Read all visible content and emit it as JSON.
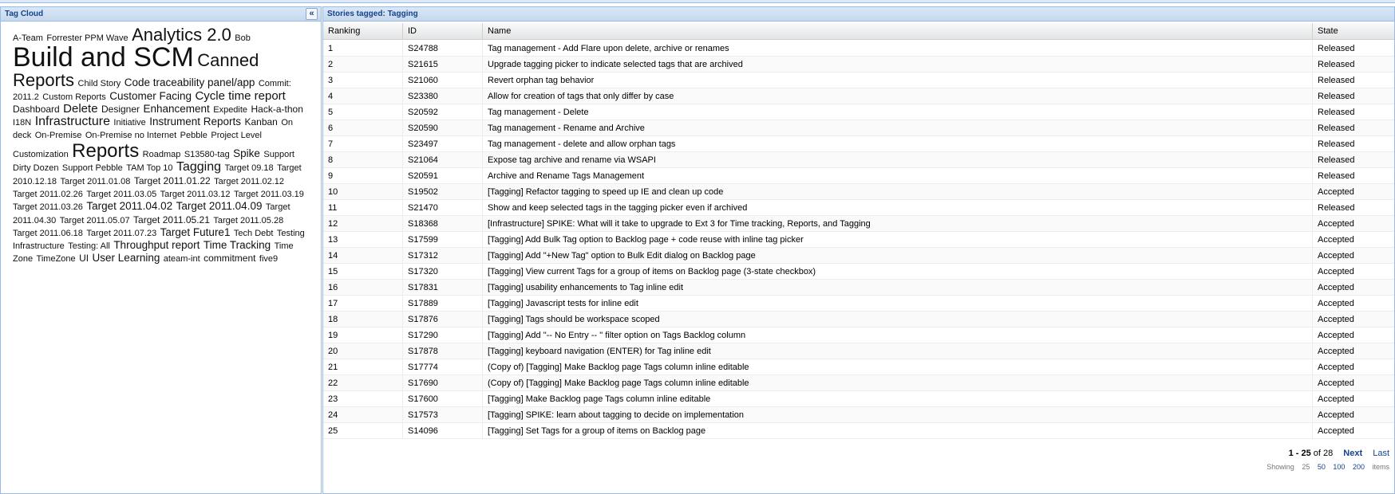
{
  "left_panel": {
    "title": "Tag Cloud",
    "collapse_icon": "«",
    "tags": [
      {
        "text": "A-Team",
        "size": "s11"
      },
      {
        "text": "Forrester PPM Wave",
        "size": "s11"
      },
      {
        "text": "Analytics 2.0",
        "size": "s22"
      },
      {
        "text": "Bob",
        "size": "s11"
      },
      {
        "text": "Build and SCM",
        "size": "s34"
      },
      {
        "text": "Canned Reports",
        "size": "s22"
      },
      {
        "text": "Child Story",
        "size": "s11"
      },
      {
        "text": "Code traceability panel/app",
        "size": "s13"
      },
      {
        "text": "Commit: 2011.2",
        "size": "s11"
      },
      {
        "text": "Custom Reports",
        "size": "s11"
      },
      {
        "text": "Customer Facing",
        "size": "s13"
      },
      {
        "text": "Cycle time report",
        "size": "s15"
      },
      {
        "text": "Dashboard",
        "size": "s12"
      },
      {
        "text": "Delete",
        "size": "s15"
      },
      {
        "text": "Designer",
        "size": "s12"
      },
      {
        "text": "Enhancement",
        "size": "s13"
      },
      {
        "text": "Expedite",
        "size": "s11"
      },
      {
        "text": "Hack-a-thon",
        "size": "s12"
      },
      {
        "text": "I18N",
        "size": "s11"
      },
      {
        "text": "Infrastructure",
        "size": "s16"
      },
      {
        "text": "Initiative",
        "size": "s11"
      },
      {
        "text": "Instrument Reports",
        "size": "s13"
      },
      {
        "text": "Kanban",
        "size": "s12"
      },
      {
        "text": "On deck",
        "size": "s11"
      },
      {
        "text": "On-Premise",
        "size": "s11"
      },
      {
        "text": "On-Premise no Internet",
        "size": "s11"
      },
      {
        "text": "Pebble",
        "size": "s11"
      },
      {
        "text": "Project Level Customization",
        "size": "s11"
      },
      {
        "text": "Reports",
        "size": "s24"
      },
      {
        "text": "Roadmap",
        "size": "s11"
      },
      {
        "text": "S13580-tag",
        "size": "s11"
      },
      {
        "text": "Spike",
        "size": "s13"
      },
      {
        "text": "Support Dirty Dozen",
        "size": "s11"
      },
      {
        "text": "Support Pebble",
        "size": "s11"
      },
      {
        "text": "TAM Top 10",
        "size": "s11"
      },
      {
        "text": "Tagging",
        "size": "s16"
      },
      {
        "text": "Target 09.18",
        "size": "s11"
      },
      {
        "text": "Target 2010.12.18",
        "size": "s11"
      },
      {
        "text": "Target 2011.01.08",
        "size": "s11"
      },
      {
        "text": "Target 2011.01.22",
        "size": "s12"
      },
      {
        "text": "Target 2011.02.12",
        "size": "s11"
      },
      {
        "text": "Target 2011.02.26",
        "size": "s11"
      },
      {
        "text": "Target 2011.03.05",
        "size": "s11"
      },
      {
        "text": "Target 2011.03.12",
        "size": "s11"
      },
      {
        "text": "Target 2011.03.19",
        "size": "s11"
      },
      {
        "text": "Target 2011.03.26",
        "size": "s11"
      },
      {
        "text": "Target 2011.04.02",
        "size": "s13"
      },
      {
        "text": "Target 2011.04.09",
        "size": "s13"
      },
      {
        "text": "Target 2011.04.30",
        "size": "s11"
      },
      {
        "text": "Target 2011.05.07",
        "size": "s11"
      },
      {
        "text": "Target 2011.05.21",
        "size": "s12"
      },
      {
        "text": "Target 2011.05.28",
        "size": "s11"
      },
      {
        "text": "Target 2011.06.18",
        "size": "s11"
      },
      {
        "text": "Target 2011.07.23",
        "size": "s11"
      },
      {
        "text": "Target Future1",
        "size": "s13"
      },
      {
        "text": "Tech Debt",
        "size": "s11"
      },
      {
        "text": "Testing Infrastructure",
        "size": "s11"
      },
      {
        "text": "Testing: All",
        "size": "s11"
      },
      {
        "text": "Throughput report",
        "size": "s13"
      },
      {
        "text": "Time Tracking",
        "size": "s13"
      },
      {
        "text": "Time Zone",
        "size": "s11"
      },
      {
        "text": "TimeZone",
        "size": "s11"
      },
      {
        "text": "UI",
        "size": "s12"
      },
      {
        "text": "User Learning",
        "size": "s13"
      },
      {
        "text": "ateam-int",
        "size": "s11"
      },
      {
        "text": "commitment",
        "size": "s12"
      },
      {
        "text": "five9",
        "size": "s11"
      }
    ]
  },
  "right_panel": {
    "title": "Stories tagged: Tagging",
    "columns": {
      "rank": "Ranking",
      "id": "ID",
      "name": "Name",
      "state": "State"
    },
    "rows": [
      {
        "rank": "1",
        "id": "S24788",
        "name": "Tag management - Add Flare upon delete, archive or renames",
        "state": "Released"
      },
      {
        "rank": "2",
        "id": "S21615",
        "name": "Upgrade tagging picker to indicate selected tags that are archived",
        "state": "Released"
      },
      {
        "rank": "3",
        "id": "S21060",
        "name": "Revert orphan tag behavior",
        "state": "Released"
      },
      {
        "rank": "4",
        "id": "S23380",
        "name": "Allow for creation of tags that only differ by case",
        "state": "Released"
      },
      {
        "rank": "5",
        "id": "S20592",
        "name": "Tag management - Delete",
        "state": "Released"
      },
      {
        "rank": "6",
        "id": "S20590",
        "name": "Tag management - Rename and Archive",
        "state": "Released"
      },
      {
        "rank": "7",
        "id": "S23497",
        "name": "Tag management - delete and allow orphan tags",
        "state": "Released"
      },
      {
        "rank": "8",
        "id": "S21064",
        "name": "Expose tag archive and rename via WSAPI",
        "state": "Released"
      },
      {
        "rank": "9",
        "id": "S20591",
        "name": "Archive and Rename Tags Management",
        "state": "Released"
      },
      {
        "rank": "10",
        "id": "S19502",
        "name": "[Tagging] Refactor tagging to speed up IE and clean up code",
        "state": "Accepted"
      },
      {
        "rank": "11",
        "id": "S21470",
        "name": "Show and keep selected tags in the tagging picker even if archived",
        "state": "Released"
      },
      {
        "rank": "12",
        "id": "S18368",
        "name": "[Infrastructure] SPIKE: What will it take to upgrade to Ext 3 for Time tracking, Reports, and Tagging",
        "state": "Accepted"
      },
      {
        "rank": "13",
        "id": "S17599",
        "name": "[Tagging] Add Bulk Tag option to Backlog page + code reuse with inline tag picker",
        "state": "Accepted"
      },
      {
        "rank": "14",
        "id": "S17312",
        "name": "[Tagging] Add \"+New Tag\" option to Bulk Edit dialog on Backlog page",
        "state": "Accepted"
      },
      {
        "rank": "15",
        "id": "S17320",
        "name": "[Tagging] View current Tags for a group of items on Backlog page (3-state checkbox)",
        "state": "Accepted"
      },
      {
        "rank": "16",
        "id": "S17831",
        "name": "[Tagging] usability enhancements to Tag inline edit",
        "state": "Accepted"
      },
      {
        "rank": "17",
        "id": "S17889",
        "name": "[Tagging] Javascript tests for inline edit",
        "state": "Accepted"
      },
      {
        "rank": "18",
        "id": "S17876",
        "name": "[Tagging] Tags should be workspace scoped",
        "state": "Accepted"
      },
      {
        "rank": "19",
        "id": "S17290",
        "name": "[Tagging] Add \"-- No Entry -- \" filter option on Tags Backlog column",
        "state": "Accepted"
      },
      {
        "rank": "20",
        "id": "S17878",
        "name": "[Tagging] keyboard navigation (ENTER) for Tag inline edit",
        "state": "Accepted"
      },
      {
        "rank": "21",
        "id": "S17774",
        "name": "(Copy of) [Tagging] Make Backlog page Tags column inline editable",
        "state": "Accepted"
      },
      {
        "rank": "22",
        "id": "S17690",
        "name": "(Copy of) [Tagging] Make Backlog page Tags column inline editable",
        "state": "Accepted"
      },
      {
        "rank": "23",
        "id": "S17600",
        "name": "[Tagging] Make Backlog page Tags column inline editable",
        "state": "Accepted"
      },
      {
        "rank": "24",
        "id": "S17573",
        "name": "[Tagging] SPIKE: learn about tagging to decide on implementation",
        "state": "Accepted"
      },
      {
        "rank": "25",
        "id": "S14096",
        "name": "[Tagging] Set Tags for a group of items on Backlog page",
        "state": "Accepted"
      }
    ],
    "pager": {
      "range": "1 - 25",
      "of_text": "of 28",
      "next": "Next",
      "last": "Last",
      "showing_label": "Showing",
      "page_sizes": [
        "25",
        "50",
        "100",
        "200"
      ],
      "items_label": "items"
    }
  }
}
